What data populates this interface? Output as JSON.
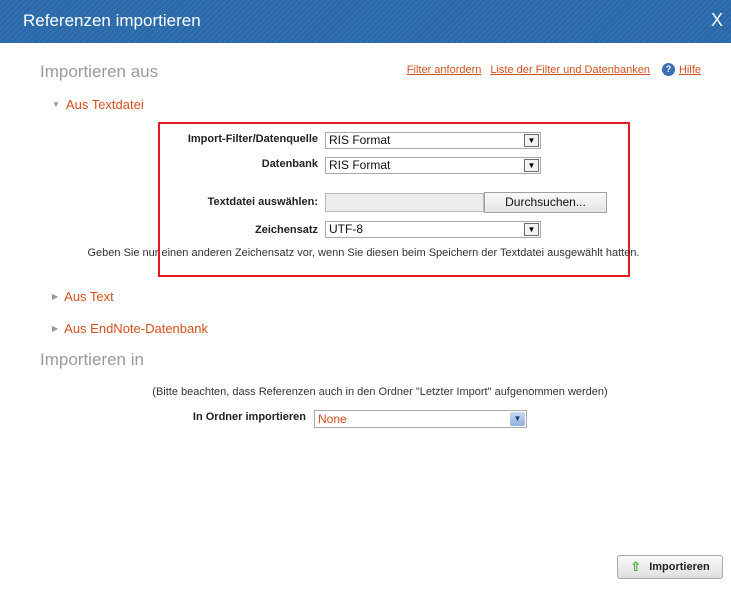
{
  "dialog": {
    "title": "Referenzen importieren",
    "close_label": "X"
  },
  "import_from": {
    "heading": "Importieren aus",
    "links": {
      "filter_request": "Filter anfordern",
      "filter_list": "Liste der Filter und Datenbanken",
      "help": "Hilfe"
    },
    "text_file": {
      "expander": "Aus Textdatei",
      "filter_label": "Import-Filter/Datenquelle",
      "filter_value": "RIS Format",
      "database_label": "Datenbank",
      "database_value": "RIS Format",
      "file_label": "Textdatei auswählen:",
      "browse_label": "Durchsuchen...",
      "charset_label": "Zeichensatz",
      "charset_value": "UTF-8",
      "charset_note": "Geben Sie nur einen anderen Zeichensatz vor, wenn Sie diesen beim Speichern der Textdatei ausgewählt hatten."
    },
    "text_expander": "Aus Text",
    "endnote_expander": "Aus EndNote-Datenbank"
  },
  "import_into": {
    "heading": "Importieren in",
    "note": "(Bitte beachten, dass Referenzen auch in den Ordner \"Letzter Import\" aufgenommen werden)",
    "folder_label": "In Ordner importieren",
    "folder_value": "None"
  },
  "actions": {
    "import_label": "Importieren"
  },
  "icons": {
    "expanded": "triangle-down-icon",
    "collapsed": "triangle-right-icon",
    "help": "help-icon",
    "dropdown": "chevron-down-icon",
    "import": "up-arrow-icon"
  },
  "colors": {
    "titlebar": "#2a6aab",
    "link": "#d2501f",
    "highlight_box": "#e01b24"
  }
}
